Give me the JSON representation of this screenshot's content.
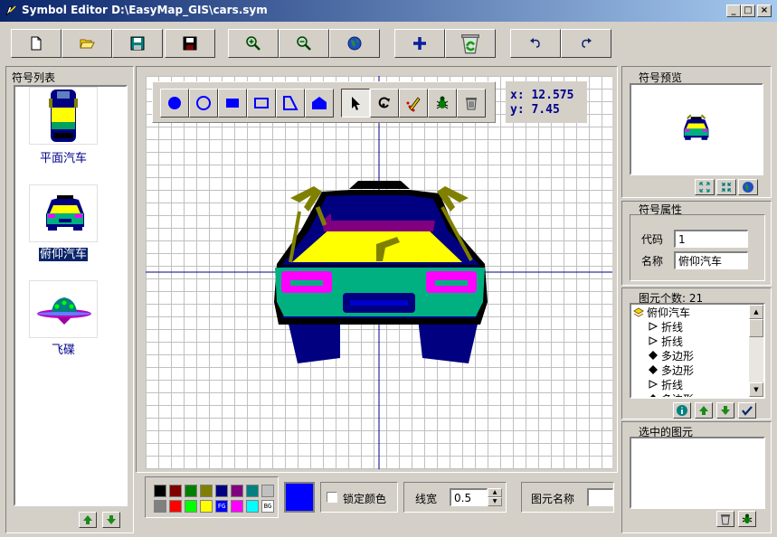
{
  "window": {
    "title": "Symbol Editor D:\\EasyMap_GIS\\cars.sym",
    "minimize": "_",
    "maximize": "□",
    "close": "×"
  },
  "toolbar": {
    "buttons": [
      "new-file-icon",
      "open-folder-icon",
      "save-icon",
      "save-as-icon",
      "zoom-in-icon",
      "zoom-out-icon",
      "globe-icon",
      "add-icon",
      "recycle-icon",
      "undo-icon",
      "redo-icon"
    ]
  },
  "symbol_list": {
    "title": "符号列表",
    "items": [
      {
        "label": "平面汽车",
        "selected": false
      },
      {
        "label": "俯仰汽车",
        "selected": true
      },
      {
        "label": "飞碟",
        "selected": false
      }
    ]
  },
  "coords": {
    "x": "x: 12.575",
    "y": "y: 7.45"
  },
  "bottom": {
    "palette_colors": [
      "#000000",
      "#800000",
      "#008000",
      "#808000",
      "#000080",
      "#800080",
      "#008080",
      "#c0c0c0",
      "#808080",
      "#ff0000",
      "#00ff00",
      "#ffff00",
      "#0000ff",
      "#ff00ff",
      "#00ffff",
      "#ffffff"
    ],
    "fg_label": "FG",
    "bg_label": "BG",
    "current_color": "#0000ff",
    "lock_color_label": "锁定颜色",
    "line_width_label": "线宽",
    "line_width_value": "0.5",
    "element_name_label": "图元名称"
  },
  "preview": {
    "title": "符号预览"
  },
  "properties": {
    "title": "符号属性",
    "code_label": "代码",
    "code_value": "1",
    "name_label": "名称",
    "name_value": "俯仰汽车"
  },
  "elements": {
    "count_label": "图元个数: 21",
    "root": "俯仰汽车",
    "items": [
      {
        "label": "折线",
        "icon": "polyline-icon"
      },
      {
        "label": "折线",
        "icon": "polyline-icon"
      },
      {
        "label": "多边形",
        "icon": "polygon-icon"
      },
      {
        "label": "多边形",
        "icon": "polygon-icon"
      },
      {
        "label": "折线",
        "icon": "polyline-icon"
      },
      {
        "label": "多边形",
        "icon": "polygon-icon"
      }
    ]
  },
  "selected_elements": {
    "title": "选中的图元"
  }
}
